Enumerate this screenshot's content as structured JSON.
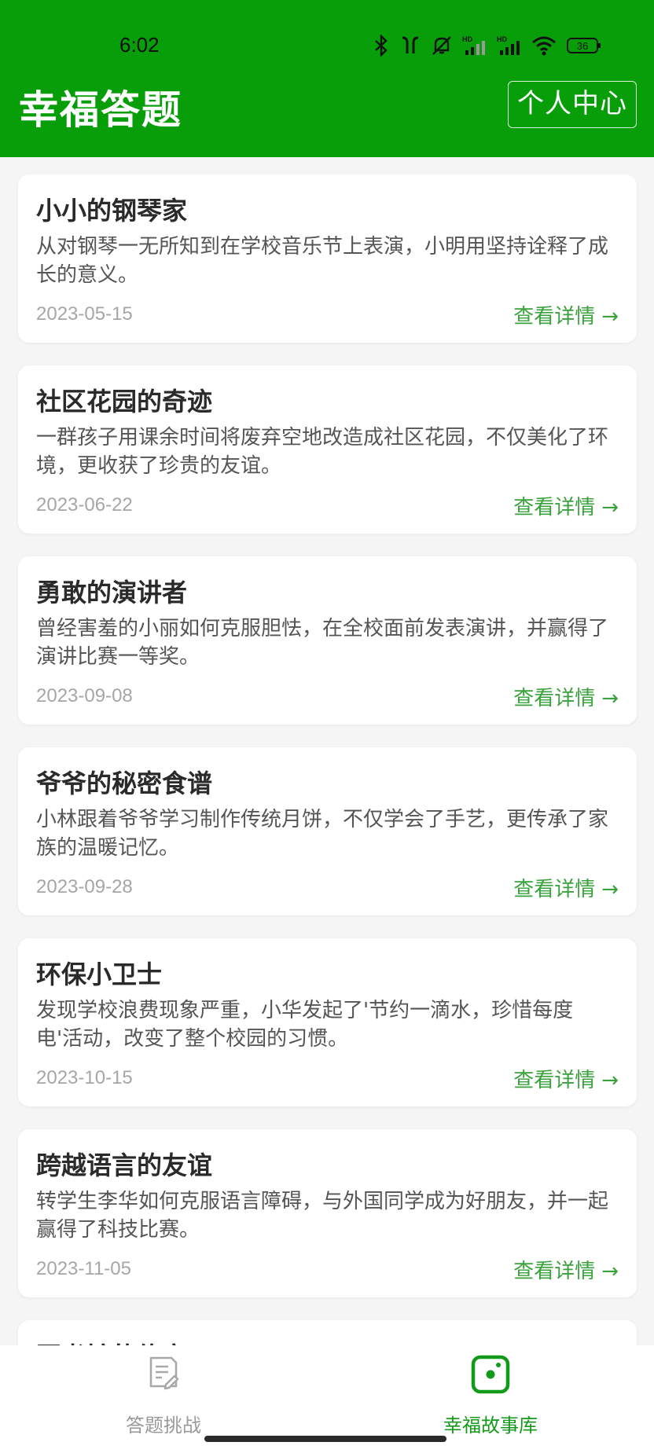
{
  "status_bar": {
    "time": "6:02",
    "battery": "36",
    "icons": [
      "bluetooth-icon",
      "earbuds-icon",
      "mute-icon",
      "signal-hd-icon",
      "signal-hd-icon",
      "wifi-icon",
      "battery-icon"
    ]
  },
  "header": {
    "title": "幸福答题",
    "profile_button": "个人中心",
    "background_color": "#089e0a"
  },
  "stories": [
    {
      "title": "小小的钢琴家",
      "summary": "从对钢琴一无所知到在学校音乐节上表演，小明用坚持诠释了成长的意义。",
      "date": "2023-05-15",
      "link": "查看详情"
    },
    {
      "title": "社区花园的奇迹",
      "summary": "一群孩子用课余时间将废弃空地改造成社区花园，不仅美化了环境，更收获了珍贵的友谊。",
      "date": "2023-06-22",
      "link": "查看详情"
    },
    {
      "title": "勇敢的演讲者",
      "summary": "曾经害羞的小丽如何克服胆怯，在全校面前发表演讲，并赢得了演讲比赛一等奖。",
      "date": "2023-09-08",
      "link": "查看详情"
    },
    {
      "title": "爷爷的秘密食谱",
      "summary": "小林跟着爷爷学习制作传统月饼，不仅学会了手艺，更传承了家族的温暖记忆。",
      "date": "2023-09-28",
      "link": "查看详情"
    },
    {
      "title": "环保小卫士",
      "summary": "发现学校浪费现象严重，小华发起了'节约一滴水，珍惜每度电'活动，改变了整个校园的习惯。",
      "date": "2023-10-15",
      "link": "查看详情"
    },
    {
      "title": "跨越语言的友谊",
      "summary": "转学生李华如何克服语言障碍，与外国同学成为好朋友，并一起赢得了科技比赛。",
      "date": "2023-11-05",
      "link": "查看详情"
    },
    {
      "title": "图书馆的约定",
      "summary": "",
      "date": "",
      "link": ""
    }
  ],
  "tabbar": {
    "tabs": [
      {
        "label": "答题挑战",
        "icon": "quiz-document-icon",
        "active": false
      },
      {
        "label": "幸福故事库",
        "icon": "story-library-icon",
        "active": true
      }
    ],
    "active_color": "#149a1b",
    "inactive_color": "#9a9a9a"
  }
}
